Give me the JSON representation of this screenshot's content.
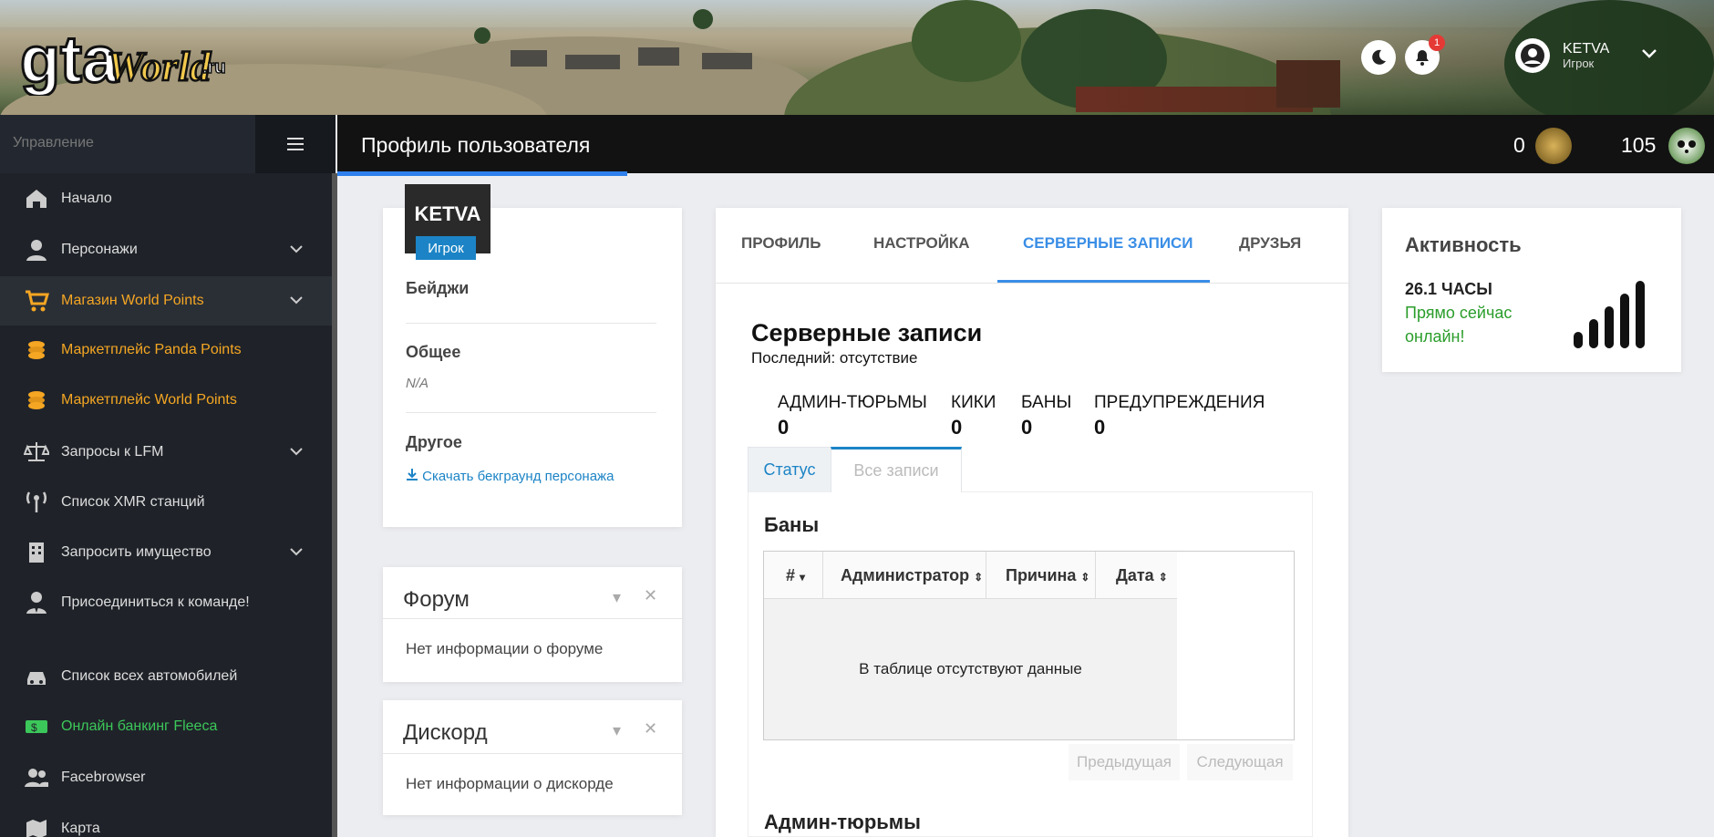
{
  "header": {
    "logo_text": "gtaWorld.ru",
    "notifications_count": "1",
    "user": {
      "name": "KETVA",
      "role": "Игрок"
    }
  },
  "topbar": {
    "title": "Профиль пользователя",
    "world_points": "0",
    "panda_points": "105"
  },
  "sidebar": {
    "header": "Управление",
    "items": [
      {
        "label": "Начало",
        "icon": "home-icon",
        "color": "default",
        "chevron": false
      },
      {
        "label": "Персонажи",
        "icon": "user-icon",
        "color": "default",
        "chevron": true
      },
      {
        "label": "Магазин World Points",
        "icon": "cart-icon",
        "color": "orange",
        "chevron": true
      },
      {
        "label": "Маркетплейс Panda Points",
        "icon": "coins-icon",
        "color": "orange",
        "chevron": false
      },
      {
        "label": "Маркетплейс World Points",
        "icon": "coins-icon",
        "color": "orange",
        "chevron": false
      },
      {
        "label": "Запросы к LFM",
        "icon": "scales-icon",
        "color": "default",
        "chevron": true
      },
      {
        "label": "Список XMR станций",
        "icon": "antenna-icon",
        "color": "default",
        "chevron": false
      },
      {
        "label": "Запросить имущество",
        "icon": "building-icon",
        "color": "default",
        "chevron": true
      },
      {
        "label": "Присоединиться к команде!",
        "icon": "user-tie-icon",
        "color": "default",
        "chevron": false
      },
      {
        "label": "Список всех автомобилей",
        "icon": "car-icon",
        "color": "default",
        "chevron": false
      },
      {
        "label": "Онлайн банкинг Fleeca",
        "icon": "money-icon",
        "color": "green",
        "chevron": false
      },
      {
        "label": "Facebrowser",
        "icon": "users-icon",
        "color": "default",
        "chevron": false
      },
      {
        "label": "Карта",
        "icon": "map-icon",
        "color": "default",
        "chevron": false
      }
    ]
  },
  "profile": {
    "name": "KETVA",
    "role": "Игрок",
    "badges_title": "Бейджи",
    "general_title": "Общее",
    "general_value": "N/A",
    "other_title": "Другое",
    "download_link": "Скачать бекграунд персонажа"
  },
  "forum_widget": {
    "title": "Форум",
    "body": "Нет информации о форуме"
  },
  "discord_widget": {
    "title": "Дискорд",
    "body": "Нет информации о дискорде"
  },
  "tabs": [
    {
      "label": "ПРОФИЛЬ",
      "active": false
    },
    {
      "label": "НАСТРОЙКА",
      "active": false
    },
    {
      "label": "СЕРВЕРНЫЕ ЗАПИСИ",
      "active": true
    },
    {
      "label": "ДРУЗЬЯ",
      "active": false
    }
  ],
  "records": {
    "title": "Серверные записи",
    "last": "Последний: отсутствие",
    "stats": [
      {
        "label": "АДМИН-ТЮРЬМЫ",
        "value": "0"
      },
      {
        "label": "КИКИ",
        "value": "0"
      },
      {
        "label": "БАНЫ",
        "value": "0"
      },
      {
        "label": "ПРЕДУПРЕЖДЕНИЯ",
        "value": "0"
      }
    ],
    "subtabs": [
      "Статус",
      "Все записи"
    ],
    "bans_title": "Баны",
    "columns": [
      "#",
      "Администратор",
      "Причина",
      "Дата"
    ],
    "empty_text": "В таблице отсутствуют данные",
    "prev": "Предыдущая",
    "next": "Следующая",
    "jail_title": "Админ-тюрьмы"
  },
  "activity": {
    "title": "Активность",
    "hours": "26.1 ЧАСЫ",
    "status": "Прямо сейчас онлайн!",
    "signal_level": 5
  },
  "colors": {
    "accent": "#3a8ee6",
    "link": "#1c84c6",
    "orange": "#f5a623",
    "green": "#3cc75a",
    "sidebar_bg": "#1f2329"
  }
}
